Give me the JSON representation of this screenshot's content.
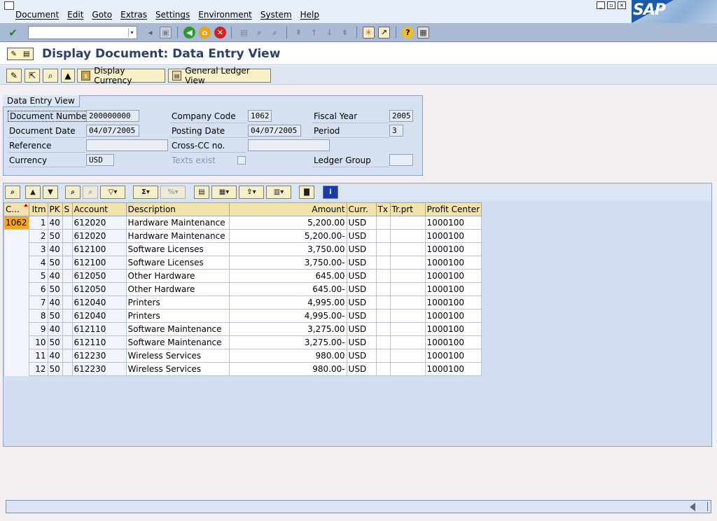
{
  "menu": [
    "Document",
    "Edit",
    "Goto",
    "Extras",
    "Settings",
    "Environment",
    "System",
    "Help"
  ],
  "logo_text": "SAP",
  "title": "Display Document: Data Entry View",
  "app_toolbar": {
    "display_currency": "Display Currency",
    "general_ledger_view": "General Ledger View"
  },
  "header": {
    "group_title": "Data Entry View",
    "document_number_label": "Document Number",
    "document_number": "200000000",
    "company_code_label": "Company Code",
    "company_code": "1062",
    "fiscal_year_label": "Fiscal Year",
    "fiscal_year": "2005",
    "document_date_label": "Document Date",
    "document_date": "04/07/2005",
    "posting_date_label": "Posting Date",
    "posting_date": "04/07/2005",
    "period_label": "Period",
    "period": "3",
    "reference_label": "Reference",
    "cross_cc_label": "Cross-CC no.",
    "currency_label": "Currency",
    "currency": "USD",
    "texts_exist_label": "Texts exist",
    "ledger_group_label": "Ledger Group"
  },
  "grid": {
    "columns": {
      "cocode": "C...",
      "itm": "Itm",
      "pk": "PK",
      "s": "S",
      "account": "Account",
      "description": "Description",
      "amount": "Amount",
      "curr": "Curr.",
      "tx": "Tx",
      "trprt": "Tr.prt",
      "profit_center": "Profit Center"
    },
    "company_code": "1062",
    "rows": [
      {
        "itm": "1",
        "pk": "40",
        "account": "612020",
        "description": "Hardware Maintenance",
        "amount": "5,200.00",
        "curr": "USD",
        "pc": "1000100"
      },
      {
        "itm": "2",
        "pk": "50",
        "account": "612020",
        "description": "Hardware Maintenance",
        "amount": "5,200.00-",
        "curr": "USD",
        "pc": "1000100"
      },
      {
        "itm": "3",
        "pk": "40",
        "account": "612100",
        "description": "Software Licenses",
        "amount": "3,750.00",
        "curr": "USD",
        "pc": "1000100"
      },
      {
        "itm": "4",
        "pk": "50",
        "account": "612100",
        "description": "Software Licenses",
        "amount": "3,750.00-",
        "curr": "USD",
        "pc": "1000100"
      },
      {
        "itm": "5",
        "pk": "40",
        "account": "612050",
        "description": "Other Hardware",
        "amount": "645.00",
        "curr": "USD",
        "pc": "1000100"
      },
      {
        "itm": "6",
        "pk": "50",
        "account": "612050",
        "description": "Other Hardware",
        "amount": "645.00-",
        "curr": "USD",
        "pc": "1000100"
      },
      {
        "itm": "7",
        "pk": "40",
        "account": "612040",
        "description": "Printers",
        "amount": "4,995.00",
        "curr": "USD",
        "pc": "1000100"
      },
      {
        "itm": "8",
        "pk": "50",
        "account": "612040",
        "description": "Printers",
        "amount": "4,995.00-",
        "curr": "USD",
        "pc": "1000100"
      },
      {
        "itm": "9",
        "pk": "40",
        "account": "612110",
        "description": "Software Maintenance",
        "amount": "3,275.00",
        "curr": "USD",
        "pc": "1000100"
      },
      {
        "itm": "10",
        "pk": "50",
        "account": "612110",
        "description": "Software Maintenance",
        "amount": "3,275.00-",
        "curr": "USD",
        "pc": "1000100"
      },
      {
        "itm": "11",
        "pk": "40",
        "account": "612230",
        "description": "Wireless Services",
        "amount": "980.00",
        "curr": "USD",
        "pc": "1000100"
      },
      {
        "itm": "12",
        "pk": "50",
        "account": "612230",
        "description": "Wireless Services",
        "amount": "980.00-",
        "curr": "USD",
        "pc": "1000100"
      }
    ]
  }
}
